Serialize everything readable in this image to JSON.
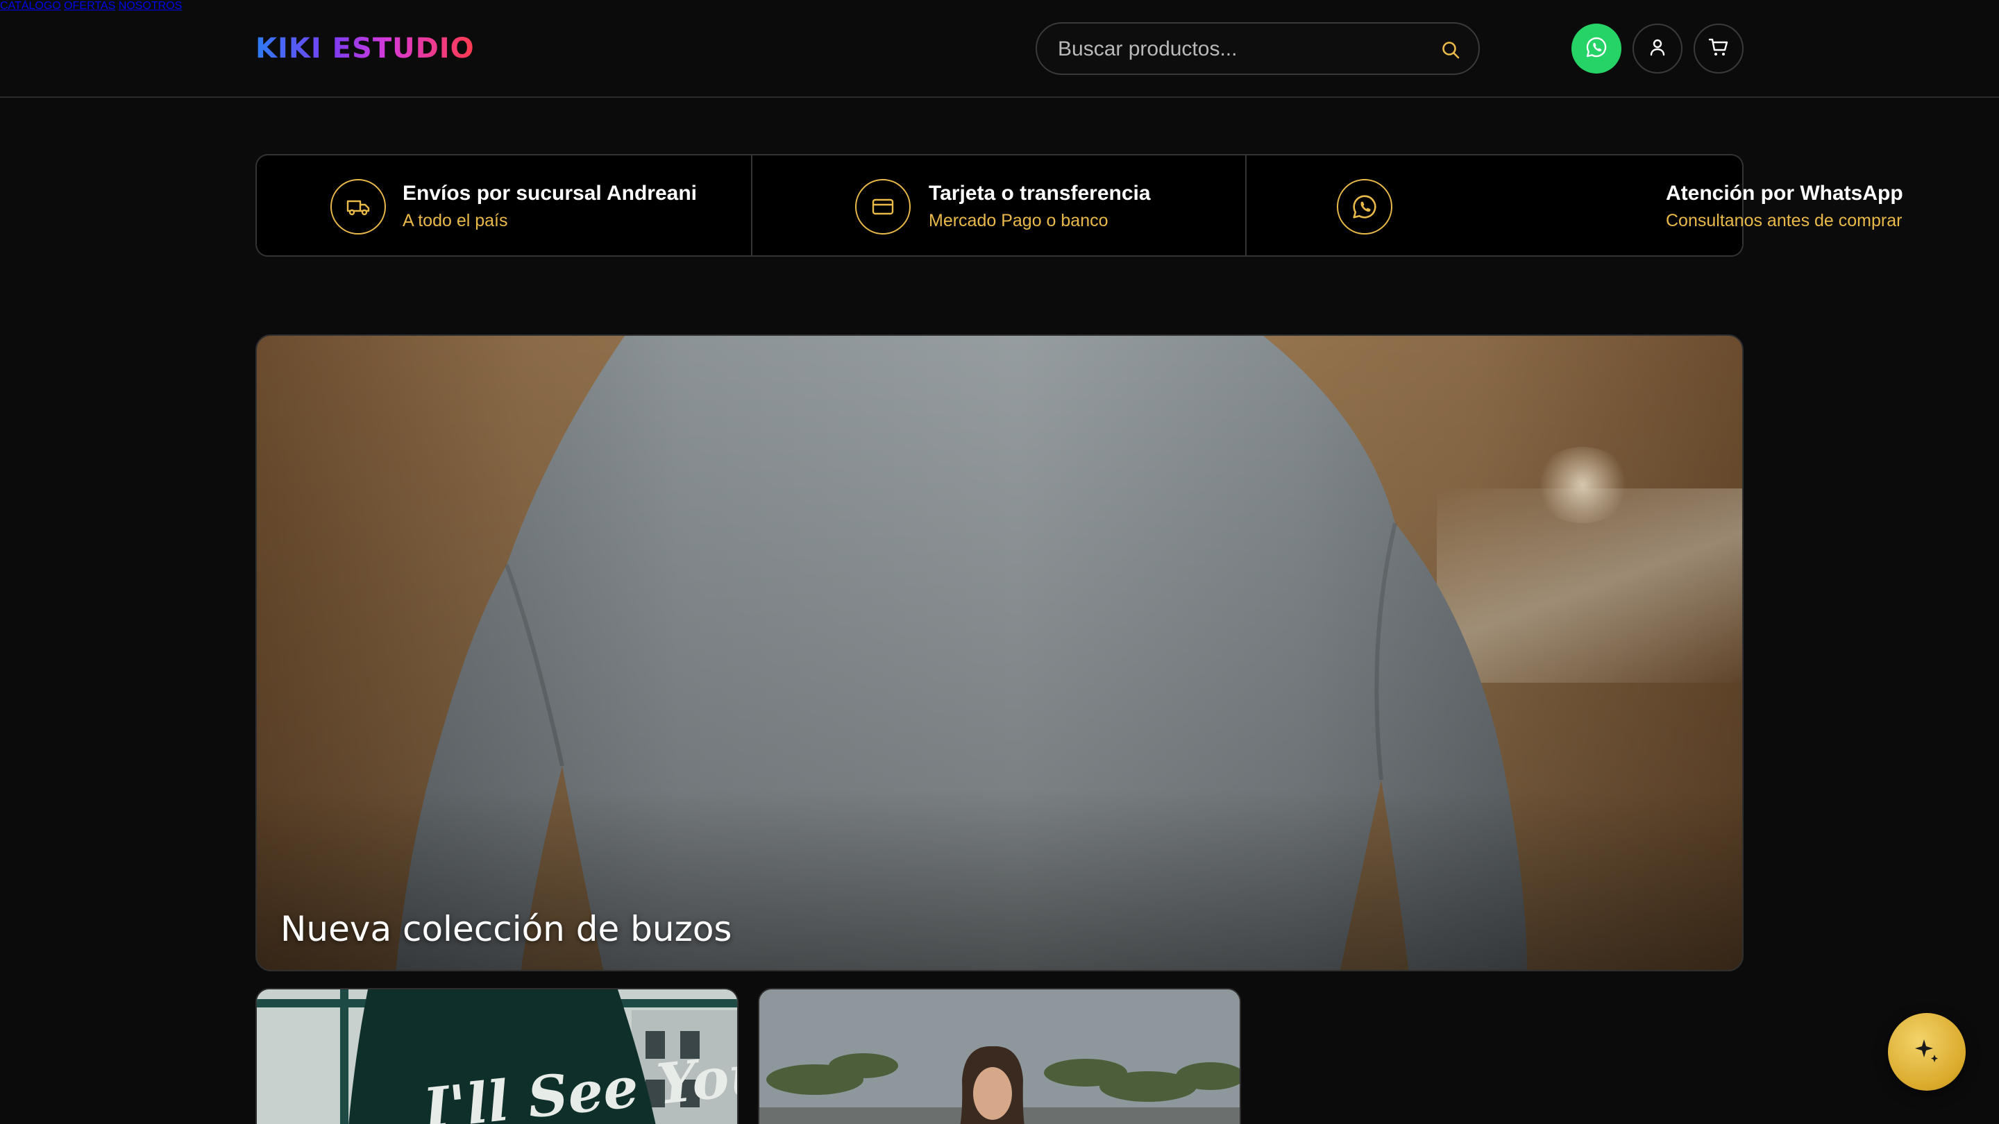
{
  "brand": {
    "logo_text": "KIKI ESTUDIO"
  },
  "nav": {
    "items": [
      {
        "label": "CATÁLOGO"
      },
      {
        "label": "OFERTAS"
      },
      {
        "label": "NOSOTROS"
      }
    ]
  },
  "search": {
    "placeholder": "Buscar productos...",
    "value": "",
    "icon": "search-icon"
  },
  "header_actions": {
    "whatsapp_icon": "whatsapp-icon",
    "user_icon": "user-icon",
    "cart_icon": "cart-icon",
    "whatsapp_color": "#25d366"
  },
  "features": [
    {
      "icon": "truck-icon",
      "title": "Envíos por sucursal Andreani",
      "subtitle": "A todo el país"
    },
    {
      "icon": "credit-card-icon",
      "title": "Tarjeta o transferencia",
      "subtitle": "Mercado Pago o banco"
    },
    {
      "icon": "whatsapp-icon",
      "title": "Atención por WhatsApp",
      "subtitle": "Consultanos antes de comprar"
    }
  ],
  "hero": {
    "caption": "Nueva colección de buzos"
  },
  "thumbnails": [
    {
      "name": "hoodie-photo",
      "print_text": "I'll See You"
    },
    {
      "name": "woman-palms-photo"
    }
  ],
  "fab": {
    "icon": "sparkle-icon"
  },
  "colors": {
    "accent": "#e9b949",
    "background": "#0b0b0b",
    "border": "#333333"
  }
}
